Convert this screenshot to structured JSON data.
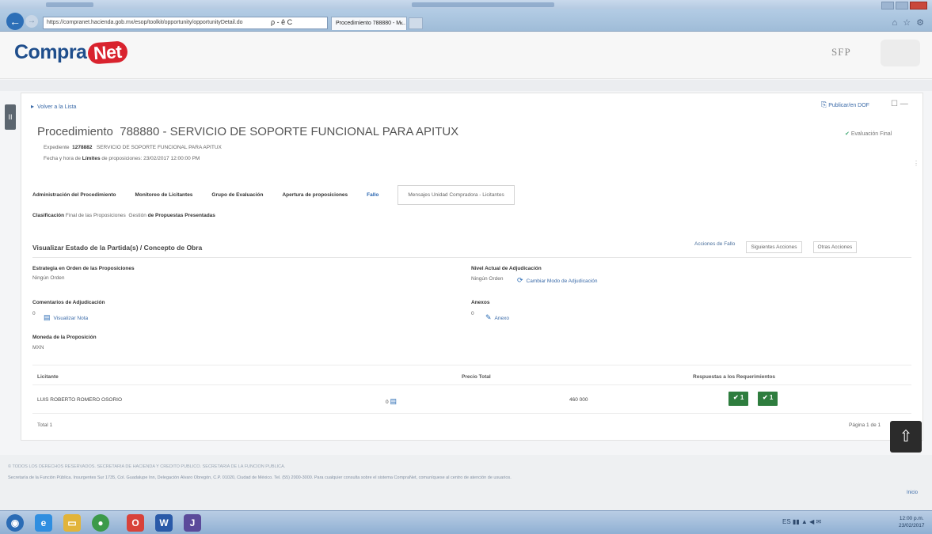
{
  "browser": {
    "address": "https://compranet.hacienda.gob.mx/esop/toolkit/opportunity/opportunityDetail.do",
    "address_controls": "ρ - ê C",
    "tab_title": "Procedimiento 788880 - M...",
    "tab_close": "×",
    "back_glyph": "←",
    "forward_glyph": "→"
  },
  "header": {
    "logo_compra": "Compra",
    "logo_net": "Net",
    "org_mark": "SFP"
  },
  "side_handle": "II",
  "page": {
    "back_link": "Volver a la Lista",
    "publish_link": "Publicar/en DOF",
    "top_controls": "☐ —",
    "procedure_label": "Procedimiento",
    "procedure_title": "788880 - SERVICIO DE SOPORTE FUNCIONAL PARA APITUX",
    "state": "Evaluación Final",
    "expediente_label": "Expediente",
    "expediente_number": "1278882",
    "expediente_title": "SERVICIO DE SOPORTE FUNCIONAL PARA APITUX",
    "meta_date_prefix": "Fecha y hora de",
    "meta_date_bold": "Límites",
    "meta_date_suffix": "de proposiciones: 23/02/2017 12:00:00 PM",
    "right_dots": "⋮"
  },
  "tabs": [
    {
      "label": "Administración del Procedimiento"
    },
    {
      "label": "Monitoreo de Licitantes"
    },
    {
      "label": "Grupo de Evaluación"
    },
    {
      "label": "Apertura de proposiciones"
    },
    {
      "label": "Fallo"
    },
    {
      "label": "Mensajes Unidad Compradora - Licitantes"
    }
  ],
  "subnav": {
    "prefix": "Clasificación",
    "mid": "Final de las Proposiciones",
    "tail_normal": "Gestión",
    "tail_bold": "de Propuestas Presentadas"
  },
  "section": {
    "title": "Visualizar Estado de la Partida(s) / Concepto de Obra",
    "actions": [
      "Acciones de Fallo",
      "Siguientes Acciones",
      "Otras Acciones"
    ]
  },
  "fields": {
    "strategy_label": "Estrategia en Orden de las Proposiciones",
    "strategy_value": "Ningún Orden",
    "level_label": "Nivel Actual de Adjudicación",
    "level_value": "Ningún Orden",
    "level_link": "Cambiar Modo de Adjudicación",
    "comments_label": "Comentarios de Adjudicación",
    "comments_count": "0",
    "comments_link": "Visualizar Nota",
    "annex_label": "Anexos",
    "annex_count": "0",
    "annex_link": "Anexo",
    "currency_label": "Moneda de la Proposición",
    "currency_value": "MXN"
  },
  "table": {
    "columns": [
      "Licitante",
      "Precio Total",
      "Respuestas a los Requerimientos"
    ],
    "rows": [
      {
        "bidder": "LUIS ROBERTO ROMERO OSORIO",
        "count": "0",
        "price": "460 000",
        "btn1": "✔ 1",
        "btn2": "✔ 1"
      }
    ],
    "total": "Total 1",
    "pager": "Página 1 de 1"
  },
  "float_icon": "⇧",
  "footer": {
    "line1": "© TODOS LOS DERECHOS RESERVADOS. SECRETARÍA DE HACIENDA Y CRÉDITO PÚBLICO. SECRETARÍA DE LA FUNCIÓN PÚBLICA.",
    "line2": "Secretaría de la Función Pública. Insurgentes Sur 1735, Col. Guadalupe Inn, Delegación Álvaro Obregón, C.P. 01020, Ciudad de México. Tel. (55) 2000-3000. Para cualquier consulta sobre el sistema CompraNet, comuníquese al centro de atención de usuarios.",
    "link": "Inicio"
  },
  "taskbar": {
    "system": "ES",
    "time": "12:00 p.m.",
    "date": "23/02/2017"
  }
}
